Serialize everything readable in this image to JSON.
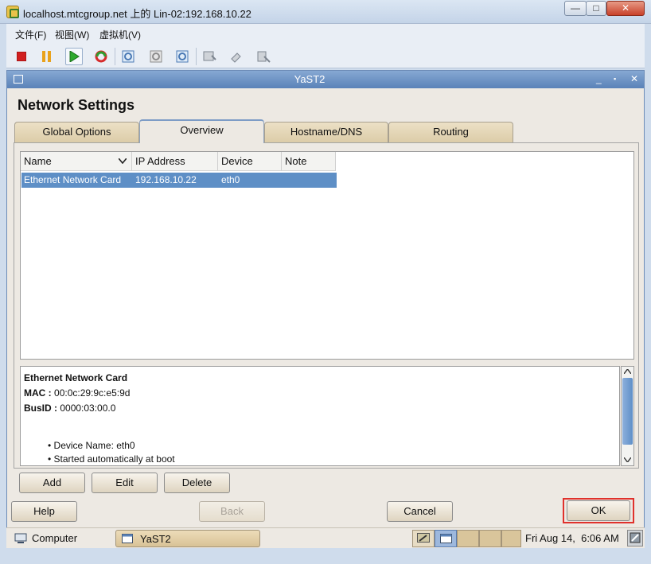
{
  "outer_window": {
    "title": "localhost.mtcgroup.net 上的 Lin-02:192.168.10.22",
    "controls": {
      "minimize": "—",
      "maximize": "□",
      "close": "✕"
    }
  },
  "menu": {
    "file": "文件(F)",
    "view": "视图(W)",
    "vm": "虚拟机(V)"
  },
  "yast_window": {
    "title": "YaST2",
    "controls": {
      "minimize": "_",
      "maximize": "▪",
      "close": "✕"
    }
  },
  "heading": "Network Settings",
  "tabs": [
    {
      "label": "Global Options"
    },
    {
      "label": "Overview"
    },
    {
      "label": "Hostname/DNS"
    },
    {
      "label": "Routing"
    }
  ],
  "table": {
    "columns": [
      "Name",
      "IP Address",
      "Device",
      "Note"
    ],
    "rows": [
      {
        "name": "Ethernet Network Card",
        "ip": "192.168.10.22",
        "device": "eth0",
        "note": ""
      }
    ]
  },
  "details": {
    "title": "Ethernet Network Card",
    "mac_label": "MAC :",
    "mac": "00:0c:29:9c:e5:9d",
    "busid_label": "BusID :",
    "busid": "0000:03:00.0",
    "bullets": [
      "Device Name: eth0",
      "Started automatically at boot"
    ]
  },
  "buttons": {
    "add": "Add",
    "edit": "Edit",
    "delete": "Delete",
    "help": "Help",
    "back": "Back",
    "cancel": "Cancel",
    "ok": "OK"
  },
  "taskbar": {
    "computer": "Computer",
    "window": "YaST2",
    "clock": "Fri Aug 14,  6:06 AM"
  }
}
